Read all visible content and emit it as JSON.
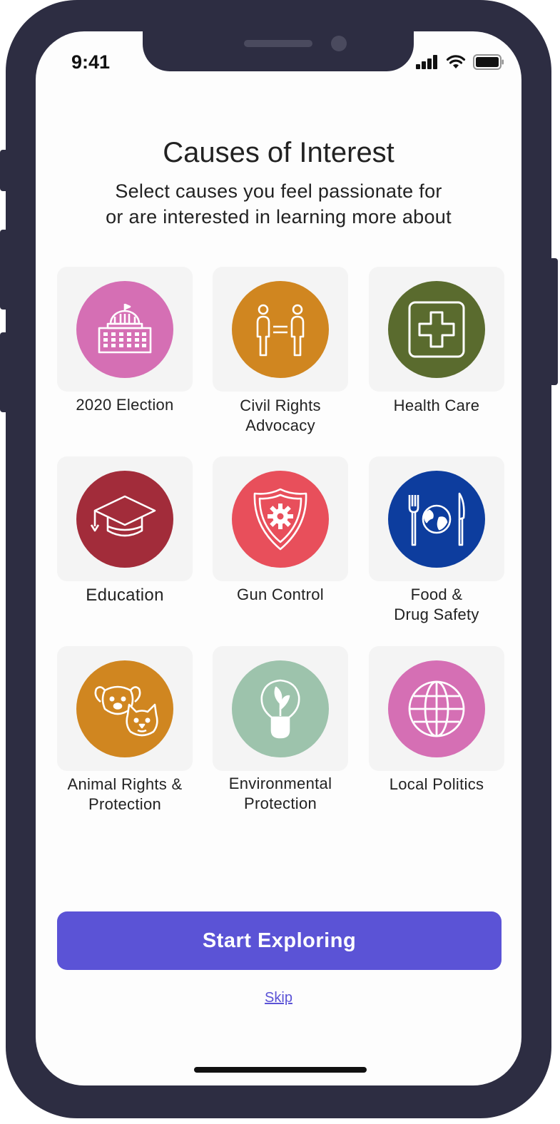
{
  "status_bar": {
    "time": "9:41"
  },
  "header": {
    "title": "Causes of Interest",
    "subtitle_line1": "Select causes you feel passionate for",
    "subtitle_line2": "or are interested in learning more about"
  },
  "causes": [
    {
      "line1": "2020 Election",
      "line2": "",
      "icon": "capitol-icon",
      "color": "#d56fb4"
    },
    {
      "line1": "Civil Rights",
      "line2": "Advocacy",
      "icon": "equality-icon",
      "color": "#d08620"
    },
    {
      "line1": "Health Care",
      "line2": "",
      "icon": "medical-cross-icon",
      "color": "#5a6b2e"
    },
    {
      "line1": "Education",
      "line2": "",
      "icon": "graduation-cap-icon",
      "color": "#a22c3a"
    },
    {
      "line1": "Gun Control",
      "line2": "",
      "icon": "shield-icon",
      "color": "#e84f5b"
    },
    {
      "line1": "Food &",
      "line2": "Drug Safety",
      "icon": "food-globe-icon",
      "color": "#0d3d9e"
    },
    {
      "line1": "Animal Rights &",
      "line2": "Protection",
      "icon": "dog-cat-icon",
      "color": "#d08620"
    },
    {
      "line1": "Environmental",
      "line2": "Protection",
      "icon": "eco-bulb-icon",
      "color": "#9dc3ac"
    },
    {
      "line1": "Local Politics",
      "line2": "",
      "icon": "globe-icon",
      "color": "#d56fb4"
    }
  ],
  "actions": {
    "primary": "Start Exploring",
    "skip": "Skip"
  },
  "colors": {
    "accent": "#5b53d6",
    "frame": "#2d2d42"
  }
}
